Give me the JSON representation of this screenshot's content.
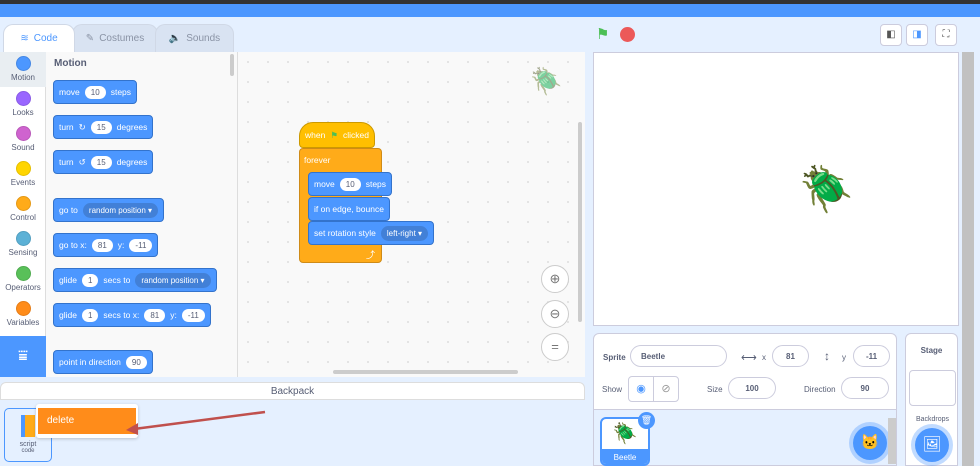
{
  "tabs": [
    {
      "label": "Code",
      "icon": "code-icon"
    },
    {
      "label": "Costumes",
      "icon": "brush-icon"
    },
    {
      "label": "Sounds",
      "icon": "speaker-icon"
    }
  ],
  "categories": [
    {
      "label": "Motion",
      "color": "#4c97ff"
    },
    {
      "label": "Looks",
      "color": "#9966ff"
    },
    {
      "label": "Sound",
      "color": "#cf63cf"
    },
    {
      "label": "Events",
      "color": "#ffd500"
    },
    {
      "label": "Control",
      "color": "#ffab19"
    },
    {
      "label": "Sensing",
      "color": "#5cb1d6"
    },
    {
      "label": "Operators",
      "color": "#59c059"
    },
    {
      "label": "Variables",
      "color": "#ff8c1a"
    }
  ],
  "palette": {
    "heading": "Motion",
    "move": {
      "a": "move",
      "v": "10",
      "b": "steps"
    },
    "turn_right": {
      "a": "turn",
      "v": "15",
      "b": "degrees"
    },
    "turn_left": {
      "a": "turn",
      "v": "15",
      "b": "degrees"
    },
    "goto": {
      "a": "go to",
      "d": "random position"
    },
    "gotoxy": {
      "a": "go to x:",
      "x": "81",
      "b": "y:",
      "y": "-11"
    },
    "glide": {
      "a": "glide",
      "v": "1",
      "b": "secs to",
      "d": "random position"
    },
    "glidexy": {
      "a": "glide",
      "v": "1",
      "b": "secs to x:",
      "x": "81",
      "c": "y:",
      "y": "-11"
    },
    "point": {
      "a": "point in direction",
      "v": "90"
    }
  },
  "script": {
    "hat": {
      "a": "when",
      "b": "clicked"
    },
    "forever": "forever",
    "move": {
      "a": "move",
      "v": "10",
      "b": "steps"
    },
    "bounce": "if on edge, bounce",
    "rotation": {
      "a": "set rotation style",
      "d": "left-right"
    }
  },
  "backpack": {
    "title": "Backpack",
    "item": {
      "label": "script",
      "sub": "code"
    },
    "menu": {
      "delete": "delete"
    }
  },
  "sprite_info": {
    "sprite_label": "Sprite",
    "sprite_name": "Beetle",
    "x_label": "x",
    "x": "81",
    "y_label": "y",
    "y": "-11",
    "show_label": "Show",
    "size_label": "Size",
    "size": "100",
    "direction_label": "Direction",
    "direction": "90"
  },
  "sprites": [
    {
      "name": "Beetle",
      "selected": true
    }
  ],
  "stage_panel": {
    "title": "Stage",
    "backdrops": "Backdrops"
  }
}
